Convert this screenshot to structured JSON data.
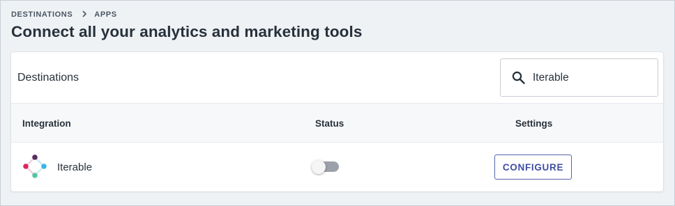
{
  "breadcrumb": {
    "items": [
      "DESTINATIONS",
      "APPS"
    ],
    "separator": ">"
  },
  "page_title": "Connect all your analytics and marketing tools",
  "card": {
    "title": "Destinations",
    "search": {
      "value": "Iterable",
      "icon": "search-icon"
    }
  },
  "table": {
    "columns": [
      "Integration",
      "Status",
      "Settings"
    ],
    "rows": [
      {
        "name": "Iterable",
        "logo": "iterable-logo",
        "status_enabled": false,
        "action": "CONFIGURE"
      }
    ]
  },
  "colors": {
    "accent": "#3f4ea4",
    "background": "#eff2f5",
    "logo_purple": "#5b2a5e",
    "logo_red": "#e0245e",
    "logo_blue": "#36b5ea",
    "logo_green": "#57c3a6"
  }
}
